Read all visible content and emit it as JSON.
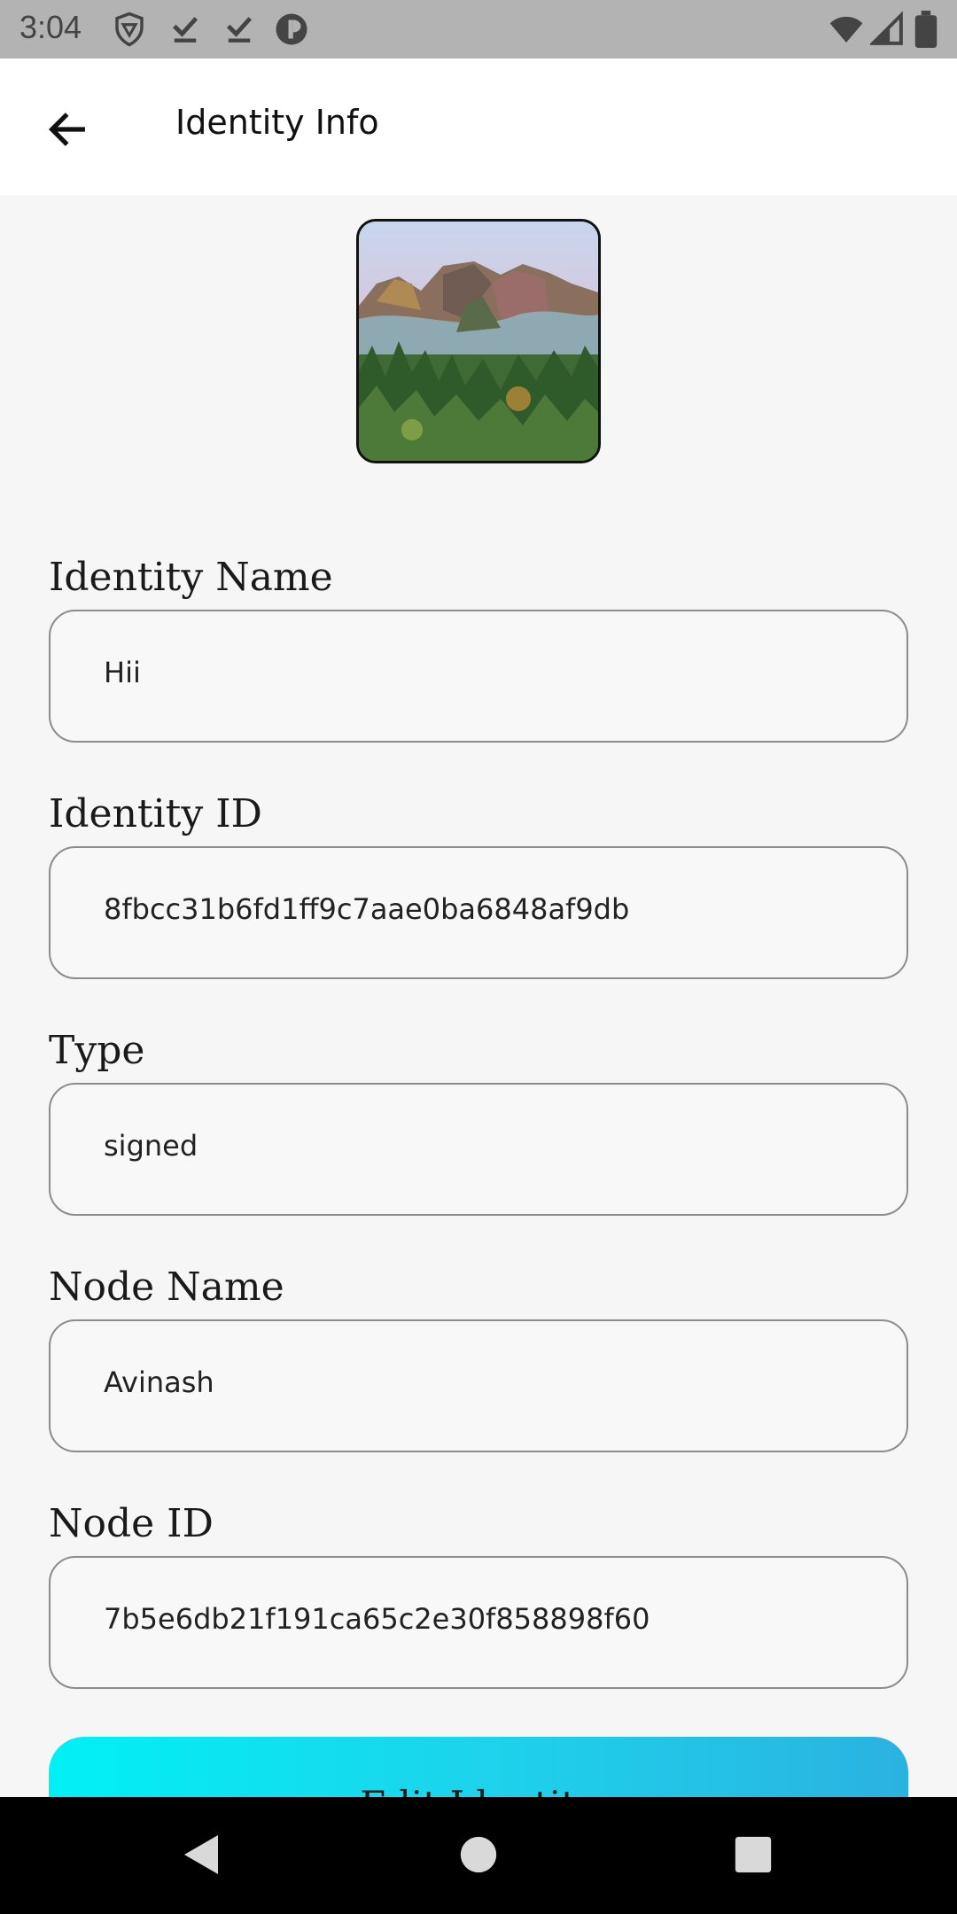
{
  "status_bar": {
    "time": "3:04",
    "icons": [
      "shield-icon",
      "download-done-icon",
      "download-done-icon",
      "pause-circle-icon",
      "wifi-icon",
      "signal-icon",
      "battery-icon"
    ]
  },
  "app_bar": {
    "title": "Identity Info",
    "back_icon": "arrow-back-icon"
  },
  "avatar": {
    "description_icon": "identity-image"
  },
  "fields": {
    "identity_name": {
      "label": "Identity Name",
      "value": "Hii"
    },
    "identity_id": {
      "label": "Identity ID",
      "value": "8fbcc31b6fd1ff9c7aae0ba6848af9db"
    },
    "type": {
      "label": "Type",
      "value": "signed"
    },
    "node_name": {
      "label": "Node Name",
      "value": "Avinash"
    },
    "node_id": {
      "label": "Node ID",
      "value": "7b5e6db21f191ca65c2e30f858898f60"
    }
  },
  "actions": {
    "edit_label": "Edit Identity"
  },
  "nav_bar": {
    "icons": [
      "nav-back-icon",
      "nav-home-icon",
      "nav-recents-icon"
    ]
  },
  "colors": {
    "accent_start": "#00f0f5",
    "accent_end": "#2ab2e0",
    "status_bar": "#b3b3b3",
    "background": "#f6f6f6"
  }
}
